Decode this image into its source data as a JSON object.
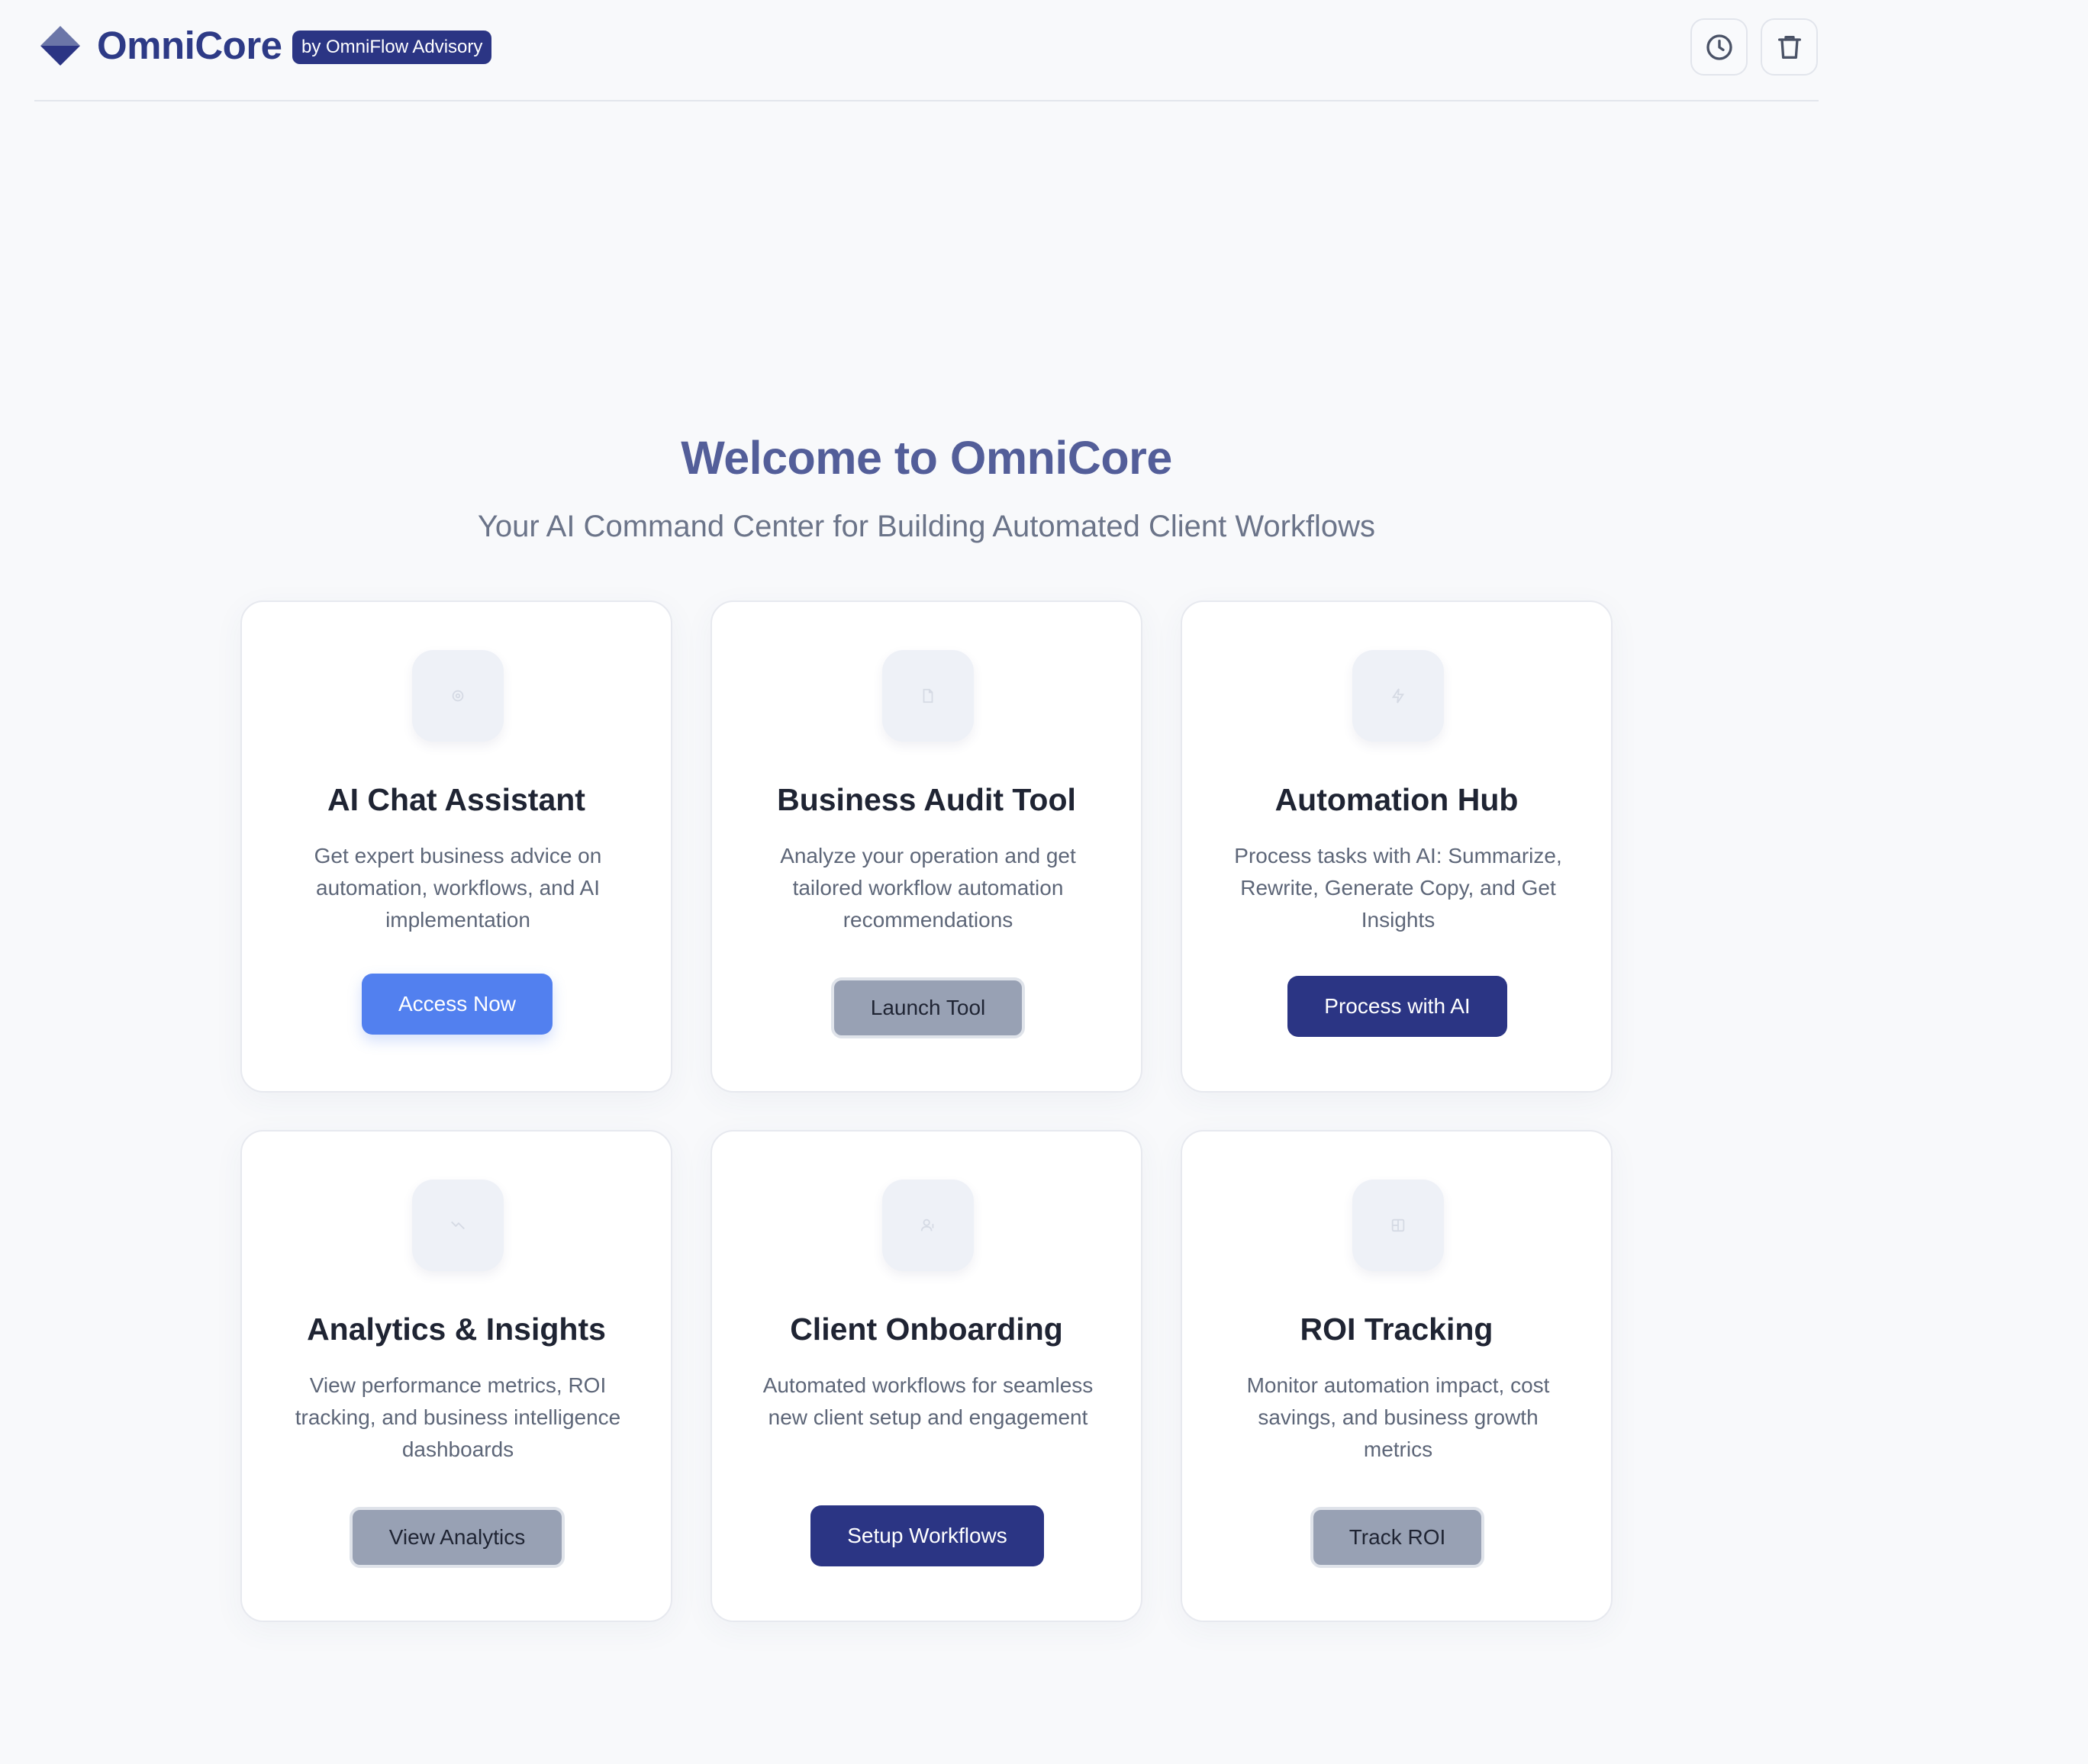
{
  "header": {
    "brand": "OmniCore",
    "badge": "by OmniFlow Advisory",
    "icons": [
      "history-icon",
      "trash-icon"
    ]
  },
  "hero": {
    "title": "Welcome to OmniCore",
    "subtitle": "Your AI Command Center for Building Automated Client Workflows"
  },
  "cards": [
    {
      "title": "AI Chat Assistant",
      "description": "Get expert business advice on automation, workflows, and AI implementation",
      "button": "Access Now",
      "icon": "chat-icon"
    },
    {
      "title": "Business Audit Tool",
      "description": "Analyze your operation and get tailored workflow automation recommendations",
      "button": "Launch Tool",
      "icon": "document-icon"
    },
    {
      "title": "Automation Hub",
      "description": "Process tasks with AI: Summarize, Rewrite, Generate Copy, and Get Insights",
      "button": "Process with AI",
      "icon": "lightning-icon"
    },
    {
      "title": "Analytics & Insights",
      "description": "View performance metrics, ROI tracking, and business intelligence dashboards",
      "button": "View Analytics",
      "icon": "analytics-icon"
    },
    {
      "title": "Client Onboarding",
      "description": "Automated workflows for seamless new client setup and engagement",
      "button": "Setup Workflows",
      "icon": "user-icon"
    },
    {
      "title": "ROI Tracking",
      "description": "Monitor automation impact, cost savings, and business growth metrics",
      "button": "Track ROI",
      "icon": "grid-icon"
    }
  ],
  "colors": {
    "brand": "#2d3a86",
    "accent_blue": "#5280ef",
    "navy": "#2b3584",
    "gray_button": "#98a1b4",
    "background": "#f8f9fb"
  }
}
